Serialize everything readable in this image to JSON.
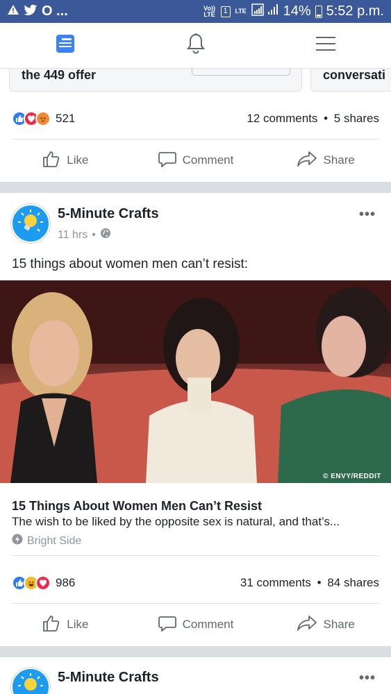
{
  "status_bar": {
    "left_glyphs": "A",
    "carrier_dots": "O ...",
    "volte_label": "Vo)) LTE",
    "sim_label": "1",
    "lte_label": "LTE",
    "battery_text": "14%",
    "time": "5:52 p.m."
  },
  "nav": {
    "items": [
      "news-feed-icon",
      "notifications-icon",
      "menu-icon"
    ],
    "accent": "#3b82f6"
  },
  "previous_post": {
    "card_left_text": "the 449 offer",
    "card_right_text": "conversati",
    "reaction_count": "521",
    "comments": "12 comments",
    "shares": "5 shares",
    "separator": "•"
  },
  "actions": {
    "like": "Like",
    "comment": "Comment",
    "share": "Share"
  },
  "post": {
    "author": "5-Minute Crafts",
    "time": "11 hrs",
    "meta_sep": "•",
    "more": "•••",
    "text": "15 things about women men can’t resist:",
    "image_watermark": "© ENVY/REDDIT",
    "link_title": "15 Things About Women Men Can’t Resist",
    "link_description": "The wish to be liked by the opposite sex is natural, and that’s...",
    "link_source": "Bright Side",
    "reaction_count": "986",
    "comments": "31 comments",
    "shares": "84 shares",
    "separator": "•"
  },
  "next_post": {
    "author": "5-Minute Crafts",
    "more": "•••"
  },
  "colors": {
    "brand": "#3b5998",
    "like_blue": "#2e7cf6",
    "love_red": "#f0284a",
    "haha_yellow": "#f7b928"
  }
}
